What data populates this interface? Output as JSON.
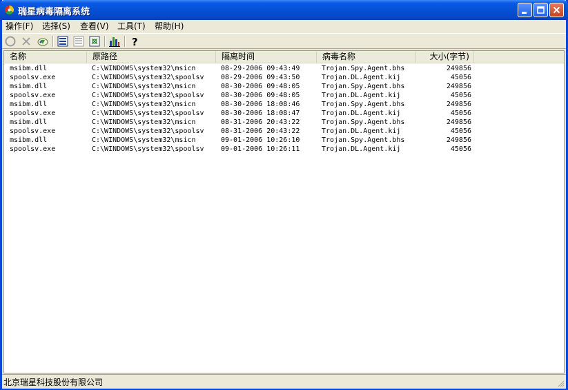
{
  "window": {
    "title": "瑞星病毒隔离系统",
    "icons": {
      "app": "rising-logo-icon",
      "minimize": "minimize-icon",
      "maximize": "maximize-icon",
      "close": "close-icon"
    }
  },
  "menu": [
    {
      "label": "操作(F)"
    },
    {
      "label": "选择(S)"
    },
    {
      "label": "查看(V)"
    },
    {
      "label": "工具(T)"
    },
    {
      "label": "帮助(H)"
    }
  ],
  "toolbar": {
    "buttons": [
      {
        "name": "restore-icon",
        "enabled": false
      },
      {
        "name": "delete-icon",
        "enabled": false
      },
      {
        "name": "add-icon",
        "enabled": true
      },
      {
        "name": "list-view-icon",
        "enabled": true
      },
      {
        "name": "details-view-icon",
        "enabled": false
      },
      {
        "name": "properties-icon",
        "enabled": true
      },
      {
        "name": "statistics-icon",
        "enabled": true
      },
      {
        "name": "help-icon",
        "enabled": true
      }
    ]
  },
  "table": {
    "columns": [
      "名称",
      "原路径",
      "隔离时间",
      "病毒名称",
      "大小(字节)"
    ],
    "rows": [
      [
        "msibm.dll",
        "C:\\WINDOWS\\system32\\msicn",
        "08-29-2006 09:43:49",
        "Trojan.Spy.Agent.bhs",
        "249856"
      ],
      [
        "spoolsv.exe",
        "C:\\WINDOWS\\system32\\spoolsv",
        "08-29-2006 09:43:50",
        "Trojan.DL.Agent.kij",
        "45056"
      ],
      [
        "msibm.dll",
        "C:\\WINDOWS\\system32\\msicn",
        "08-30-2006 09:48:05",
        "Trojan.Spy.Agent.bhs",
        "249856"
      ],
      [
        "spoolsv.exe",
        "C:\\WINDOWS\\system32\\spoolsv",
        "08-30-2006 09:48:05",
        "Trojan.DL.Agent.kij",
        "45056"
      ],
      [
        "msibm.dll",
        "C:\\WINDOWS\\system32\\msicn",
        "08-30-2006 18:08:46",
        "Trojan.Spy.Agent.bhs",
        "249856"
      ],
      [
        "spoolsv.exe",
        "C:\\WINDOWS\\system32\\spoolsv",
        "08-30-2006 18:08:47",
        "Trojan.DL.Agent.kij",
        "45056"
      ],
      [
        "msibm.dll",
        "C:\\WINDOWS\\system32\\msicn",
        "08-31-2006 20:43:22",
        "Trojan.Spy.Agent.bhs",
        "249856"
      ],
      [
        "spoolsv.exe",
        "C:\\WINDOWS\\system32\\spoolsv",
        "08-31-2006 20:43:22",
        "Trojan.DL.Agent.kij",
        "45056"
      ],
      [
        "msibm.dll",
        "C:\\WINDOWS\\system32\\msicn",
        "09-01-2006 10:26:10",
        "Trojan.Spy.Agent.bhs",
        "249856"
      ],
      [
        "spoolsv.exe",
        "C:\\WINDOWS\\system32\\spoolsv",
        "09-01-2006 10:26:11",
        "Trojan.DL.Agent.kij",
        "45056"
      ]
    ]
  },
  "status": {
    "text": "北京瑞星科技股份有限公司"
  },
  "colors": {
    "titlebar": "#0551d6",
    "window_bg": "#ece9d8",
    "accent_blue": "#0a46d8"
  }
}
